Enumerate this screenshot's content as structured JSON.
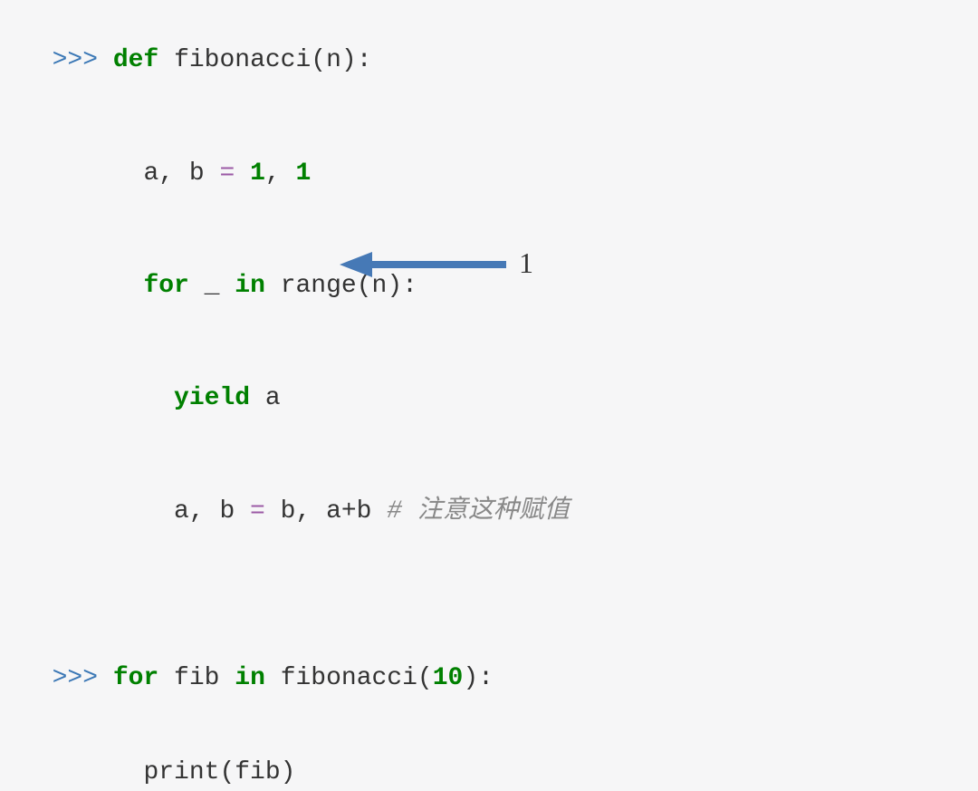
{
  "lines": {
    "l1": {
      "prompt": ">>> ",
      "kw_def": "def",
      "sp1": " ",
      "fname": "fibonacci",
      "args": "(n):"
    },
    "l2": {
      "indent": "      ",
      "lhs": "a, b ",
      "eq": "= ",
      "n1": "1",
      "comma": ", ",
      "n2": "1"
    },
    "l3": {
      "indent": "      ",
      "kw_for": "for",
      "mid": " _ ",
      "kw_in": "in",
      "rest": " range(n):"
    },
    "l4": {
      "indent": "        ",
      "kw_yield": "yield",
      "rest": " a"
    },
    "l5": {
      "indent": "        ",
      "lhs": "a, b ",
      "eq": "= ",
      "rhs": "b, a+b ",
      "comment": "# 注意这种赋值"
    },
    "l6": {
      "prompt": ">>> ",
      "kw_for": "for",
      "mid": " fib ",
      "kw_in": "in",
      "sp": " ",
      "fname": "fibonacci",
      "open": "(",
      "arg": "10",
      "close": "):"
    },
    "l7": {
      "indent": "      ",
      "text": "print(fib)"
    }
  },
  "annotation": {
    "label": "1"
  }
}
